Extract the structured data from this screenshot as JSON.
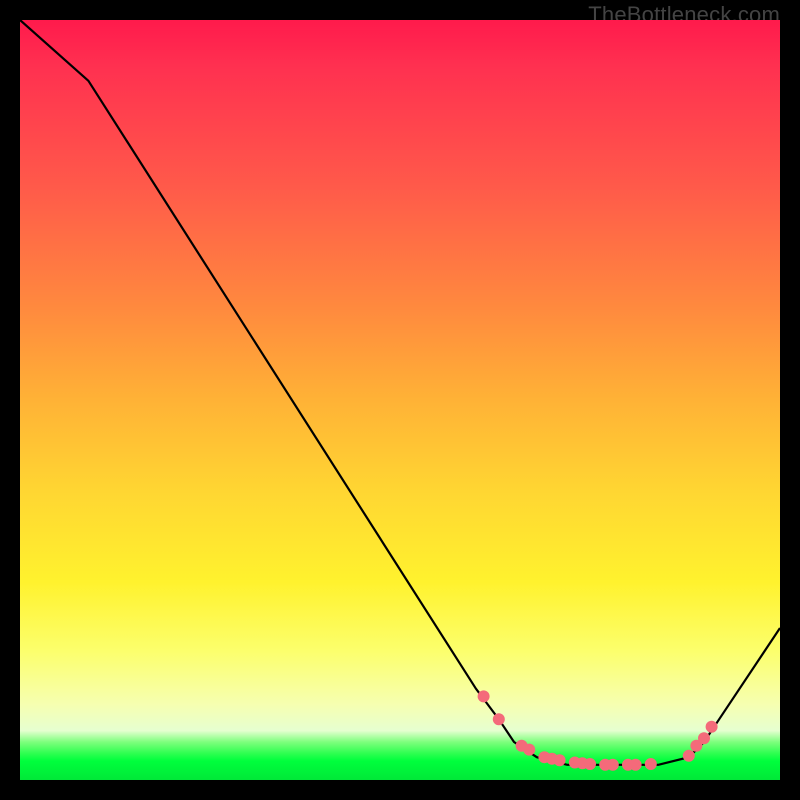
{
  "watermark": {
    "text": "TheBottleneck.com"
  },
  "chart_data": {
    "type": "line",
    "title": "",
    "xlabel": "",
    "ylabel": "",
    "xlim": [
      0,
      100
    ],
    "ylim": [
      0,
      100
    ],
    "x": [
      0,
      9,
      60,
      63,
      65,
      68,
      72,
      78,
      84,
      88,
      90,
      92,
      100
    ],
    "values": [
      100,
      92,
      12,
      8,
      5,
      3,
      2,
      2,
      2,
      3,
      5,
      8,
      20
    ],
    "markers_x": [
      61,
      63,
      66,
      67,
      69,
      70,
      71,
      73,
      74,
      75,
      77,
      78,
      80,
      81,
      83,
      88,
      89,
      90,
      91
    ],
    "markers_y": [
      11,
      8,
      4.5,
      4,
      3,
      2.8,
      2.6,
      2.3,
      2.2,
      2.1,
      2.0,
      2.0,
      2.0,
      2.0,
      2.1,
      3.2,
      4.5,
      5.5,
      7.0
    ],
    "marker_color": "#f46a7a",
    "line_color": "#000000"
  }
}
